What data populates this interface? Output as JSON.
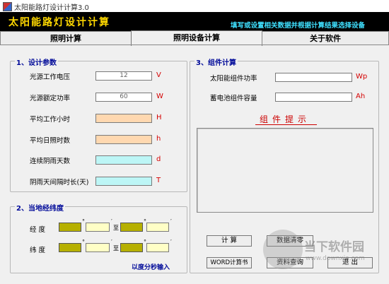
{
  "window": {
    "title": "太阳能路灯设计计算3.0"
  },
  "banner": {
    "title": "太阳能路灯设计计算",
    "hint": "填写或设置相关数据并根据计算结果选择设备"
  },
  "tabs": [
    {
      "label": "照明计算"
    },
    {
      "label": "照明设备计算"
    },
    {
      "label": "关于软件"
    }
  ],
  "design": {
    "title": "1、设计参数",
    "fields": [
      {
        "label": "光源工作电压",
        "value": "12",
        "unit": "V"
      },
      {
        "label": "光源额定功率",
        "value": "60",
        "unit": "W"
      },
      {
        "label": "平均工作小时",
        "value": "",
        "unit": "H"
      },
      {
        "label": "平均日照时数",
        "value": "",
        "unit": "h"
      },
      {
        "label": "连续阴雨天数",
        "value": "",
        "unit": "d"
      },
      {
        "label": "阴雨天间隔时长(天)",
        "value": "",
        "unit": "T"
      }
    ]
  },
  "geo": {
    "title": "2、当地经纬度",
    "longitude_label": "经 度",
    "latitude_label": "纬 度",
    "to": "至",
    "deg_mark": "°",
    "min_mark": "′",
    "dms_note": "以度分秒输入"
  },
  "component": {
    "title": "3、组件计算",
    "fields": [
      {
        "label": "太阳能组件功率",
        "value": "",
        "unit": "Wp"
      },
      {
        "label": "蓄电池组件容量",
        "value": "",
        "unit": "Ah"
      }
    ],
    "hint": "组件提示"
  },
  "buttons": {
    "calc": "计  算",
    "clear": "数据清零",
    "word": "WORD计算书",
    "query": "资料查询",
    "exit": "退  出"
  },
  "watermark": {
    "text": "当下软件园",
    "url": "www.downxia.com"
  }
}
